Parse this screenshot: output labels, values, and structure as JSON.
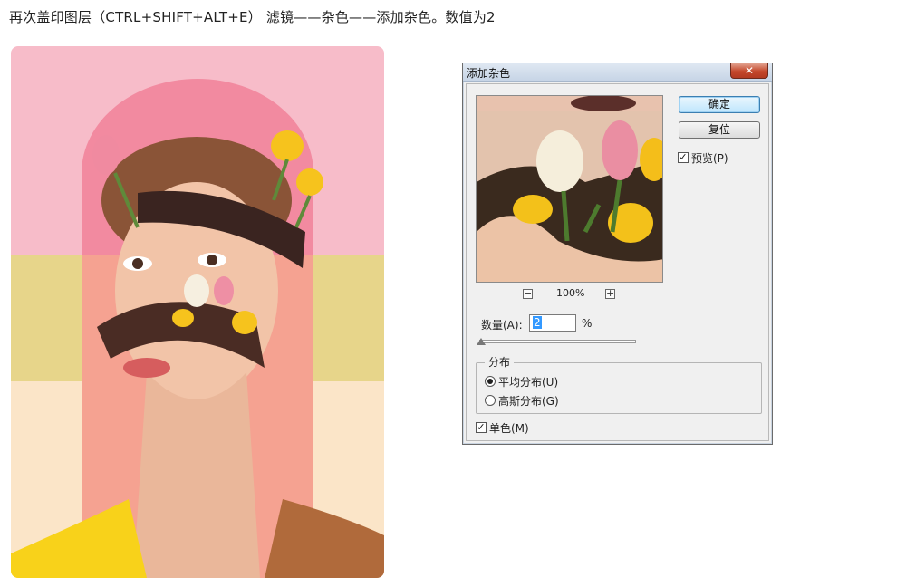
{
  "caption": "再次盖印图层（CTRL+SHIFT+ALT+E） 滤镜——杂色——添加杂色。数值为2",
  "poster": {
    "bg_top": "#f7bcc9",
    "band_yellow": "#e7d58a",
    "band_cream": "#fbe5c8",
    "arch": "#f28aa0",
    "skin": "#f2c4a8",
    "hair": "#8a5437",
    "yellow_shirt": "#f8d21a",
    "brown_top": "#b06a3b"
  },
  "dialog": {
    "title": "添加杂色",
    "close_glyph": "✕",
    "zoom_minus": "−",
    "zoom_level": "100%",
    "zoom_plus": "+",
    "ok_label": "确定",
    "reset_label": "复位",
    "preview_checked_glyph": "✓",
    "preview_label": "预览(P)",
    "amount_label": "数量(A):",
    "amount_value": "2",
    "amount_unit": "%",
    "distribution_title": "分布",
    "uniform_label": "平均分布(U)",
    "gaussian_label": "高斯分布(G)",
    "distribution_selected": "uniform",
    "mono_checked_glyph": "✓",
    "mono_label": "单色(M)"
  }
}
